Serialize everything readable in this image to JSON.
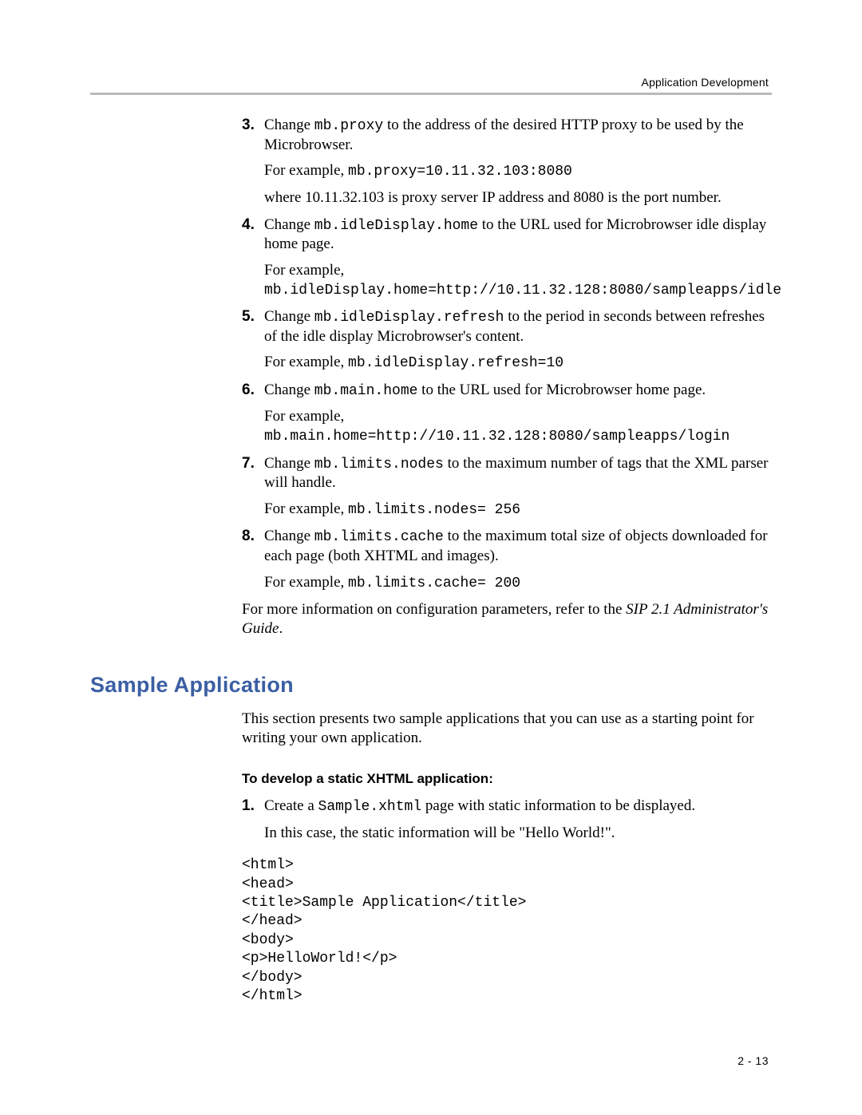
{
  "runningHead": "Application Development",
  "pageNumber": "2 - 13",
  "sectionTitle": "Sample Application",
  "moreInfo_a": "For more information on configuration parameters, refer to the ",
  "moreInfo_b": "SIP 2.1 Administrator's Guide",
  "moreInfo_c": ".",
  "intro2": "This section presents two sample applications that you can use as a starting point for writing your own application.",
  "subhead1": "To develop a static XHTML application:",
  "steps": [
    {
      "n": "3.",
      "a": "Change ",
      "code1": "mb.proxy",
      "b": " to the address of the desired HTTP proxy to be used by the Microbrowser.",
      "ex_a": "For example, ",
      "ex_code": "mb.proxy=10.11.32.103:8080",
      "ex_b": "",
      "extra": "where 10.11.32.103 is proxy server IP address and 8080 is the port number."
    },
    {
      "n": "4.",
      "a": "Change ",
      "code1": "mb.idleDisplay.home",
      "b": " to the URL used for Microbrowser idle display home page.",
      "ex_a": "For example, ",
      "ex_code": "mb.idleDisplay.home=http://10.11.32.128:8080/sampleapps/idle",
      "ex_b": "",
      "extra": ""
    },
    {
      "n": "5.",
      "a": "Change ",
      "code1": "mb.idleDisplay.refresh",
      "b": " to the period in seconds between refreshes of the idle display Microbrowser's content.",
      "ex_a": "For example, ",
      "ex_code": "mb.idleDisplay.refresh=10",
      "ex_b": "",
      "extra": ""
    },
    {
      "n": "6.",
      "a": "Change ",
      "code1": "mb.main.home",
      "b": " to the URL used for Microbrowser home page.",
      "ex_a": "For example, ",
      "ex_code": "mb.main.home=http://10.11.32.128:8080/sampleapps/login",
      "ex_b": "",
      "extra": ""
    },
    {
      "n": "7.",
      "a": "Change ",
      "code1": "mb.limits.nodes",
      "b": " to the maximum number of tags that the XML parser will handle.",
      "ex_a": "For example, ",
      "ex_code": "mb.limits.nodes= 256",
      "ex_b": "",
      "extra": ""
    },
    {
      "n": "8.",
      "a": "Change ",
      "code1": "mb.limits.cache",
      "b": " to the maximum total size of objects downloaded for each page (both XHTML and images).",
      "ex_a": "For example, ",
      "ex_code": "mb.limits.cache= 200",
      "ex_b": "",
      "extra": ""
    }
  ],
  "sample": {
    "step1": {
      "n": "1.",
      "a": "Create a ",
      "code1": "Sample.xhtml",
      "b": " page with static information to be displayed.",
      "extra": "In this case, the static information will be \"Hello World!\"."
    },
    "code": "<html>\n<head>\n<title>Sample Application</title>\n</head>\n<body>\n<p>HelloWorld!</p>\n</body>\n</html>"
  }
}
